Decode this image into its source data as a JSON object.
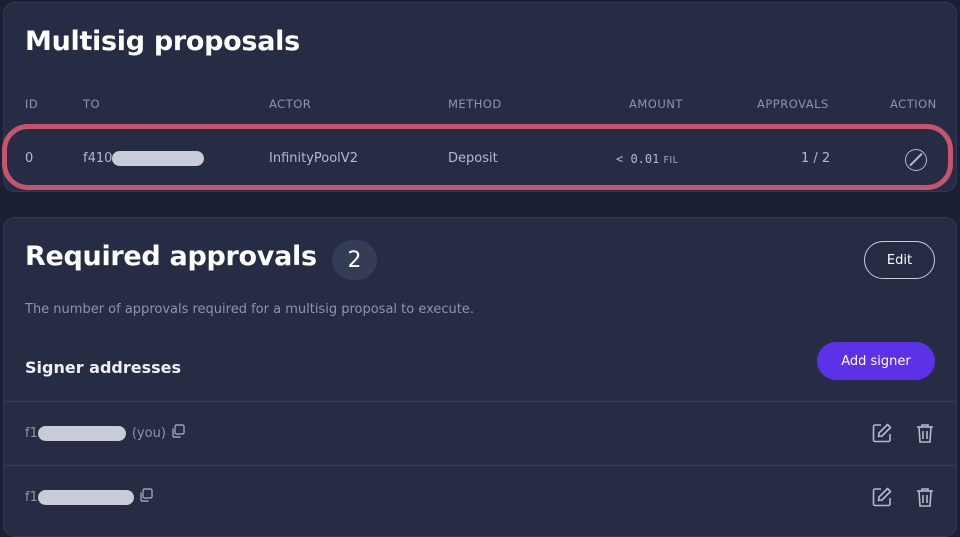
{
  "proposals": {
    "title": "Multisig proposals",
    "columns": {
      "id": "ID",
      "to": "TO",
      "actor": "ACTOR",
      "method": "METHOD",
      "amount": "AMOUNT",
      "approvals": "APPROVALS",
      "action": "ACTION"
    },
    "rows": [
      {
        "id": "0",
        "to_prefix": "f410",
        "actor": "InfinityPoolV2",
        "method": "Deposit",
        "amount": "< 0.01",
        "amount_unit": "FIL",
        "approvals": "1 / 2",
        "action_icon": "cancel-icon"
      }
    ]
  },
  "approvals": {
    "title": "Required approvals",
    "count": "2",
    "edit_label": "Edit",
    "description": "The number of approvals required for a multisig proposal to execute.",
    "signers_label": "Signer addresses",
    "add_signer_label": "Add signer",
    "signers": [
      {
        "prefix": "f1",
        "suffix": "(you)"
      },
      {
        "prefix": "f1",
        "suffix": ""
      }
    ]
  },
  "colors": {
    "page_bg": "#1b2034",
    "card_bg": "#262c44",
    "accent_purple": "#5b32e8",
    "highlight_pink": "#c5556f"
  }
}
